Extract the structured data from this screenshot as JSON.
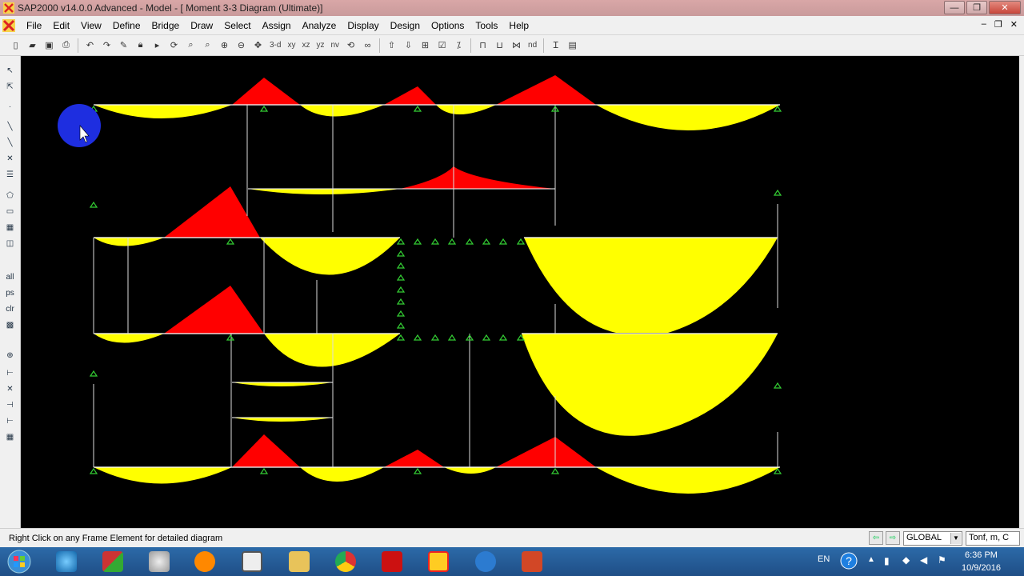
{
  "window": {
    "title": "SAP2000 v14.0.0 Advanced  - Model - [  Moment 3-3 Diagram  (Ultimate)]",
    "controls": {
      "minimize": "—",
      "maximize": "❐",
      "close": "✕"
    }
  },
  "menu": {
    "items": [
      "File",
      "Edit",
      "View",
      "Define",
      "Bridge",
      "Draw",
      "Select",
      "Assign",
      "Analyze",
      "Display",
      "Design",
      "Options",
      "Tools",
      "Help"
    ],
    "mdi_controls": [
      "–",
      "❐",
      "✕"
    ]
  },
  "toolbar": {
    "view_labels": [
      "3-d",
      "xy",
      "xz",
      "yz",
      "nv"
    ],
    "misc_labels": [
      "nd"
    ]
  },
  "left_toolbar": {
    "labels": [
      "all",
      "ps",
      "clr"
    ]
  },
  "canvas": {
    "background": "#000000",
    "positive_color": "#ffff00",
    "negative_color": "#ff0000",
    "frame_color": "#ffffff",
    "support_color": "#33cc33"
  },
  "status": {
    "message": "Right Click on any Frame Element for detailed diagram",
    "coord_system": "GLOBAL",
    "units": "Tonf, m, C"
  },
  "taskbar": {
    "language": "EN",
    "time": "6:36 PM",
    "date": "10/9/2016",
    "apps": [
      "start",
      "internet-explorer",
      "office-app",
      "paint",
      "media-player",
      "calendar",
      "file-explorer",
      "chrome",
      "autocad",
      "sap2000",
      "outlook",
      "powerpoint"
    ]
  }
}
